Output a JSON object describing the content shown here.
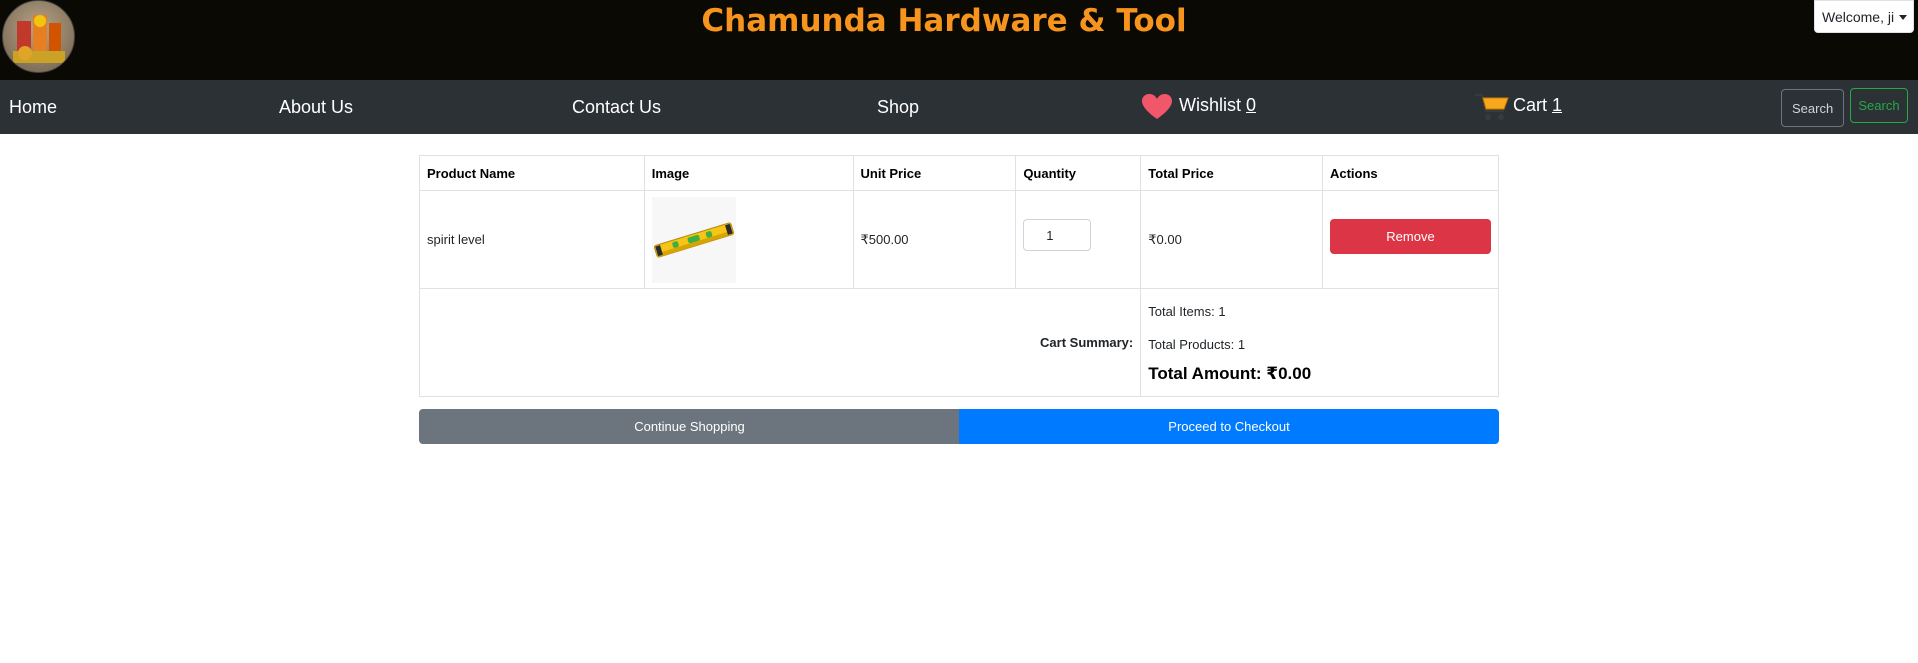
{
  "header": {
    "site_title": "Chamunda Hardware & Tool",
    "user_menu_label": "Welcome, ji"
  },
  "nav": {
    "home": "Home",
    "about": "About Us",
    "contact": "Contact Us",
    "shop": "Shop",
    "wishlist_label": "Wishlist",
    "wishlist_count": "0",
    "cart_label": "Cart",
    "cart_count": "1",
    "search_placeholder": "Search",
    "search_button": "Search"
  },
  "cart_table": {
    "headers": [
      "Product Name",
      "Image",
      "Unit Price",
      "Quantity",
      "Total Price",
      "Actions"
    ],
    "rows": [
      {
        "product_name": "spirit level",
        "unit_price": "₹500.00",
        "quantity": "1",
        "total_price": "₹0.00",
        "action_label": "Remove"
      }
    ],
    "summary": {
      "label": "Cart Summary:",
      "total_items": "Total Items: 1",
      "total_products": "Total Products: 1",
      "total_amount": "Total Amount: ₹0.00"
    }
  },
  "actions": {
    "continue_shopping": "Continue Shopping",
    "proceed_checkout": "Proceed to Checkout"
  },
  "colors": {
    "header_bg": "#0b0904",
    "title_orange": "#f7941d",
    "navbar_bg": "#2c3136",
    "remove_red": "#dc3545",
    "continue_gray": "#6c757d",
    "checkout_blue": "#007bff",
    "search_green": "#28a745"
  },
  "icons": {
    "wishlist": "heart-icon",
    "cart": "shopping-cart-icon",
    "caret": "caret-down-icon"
  }
}
